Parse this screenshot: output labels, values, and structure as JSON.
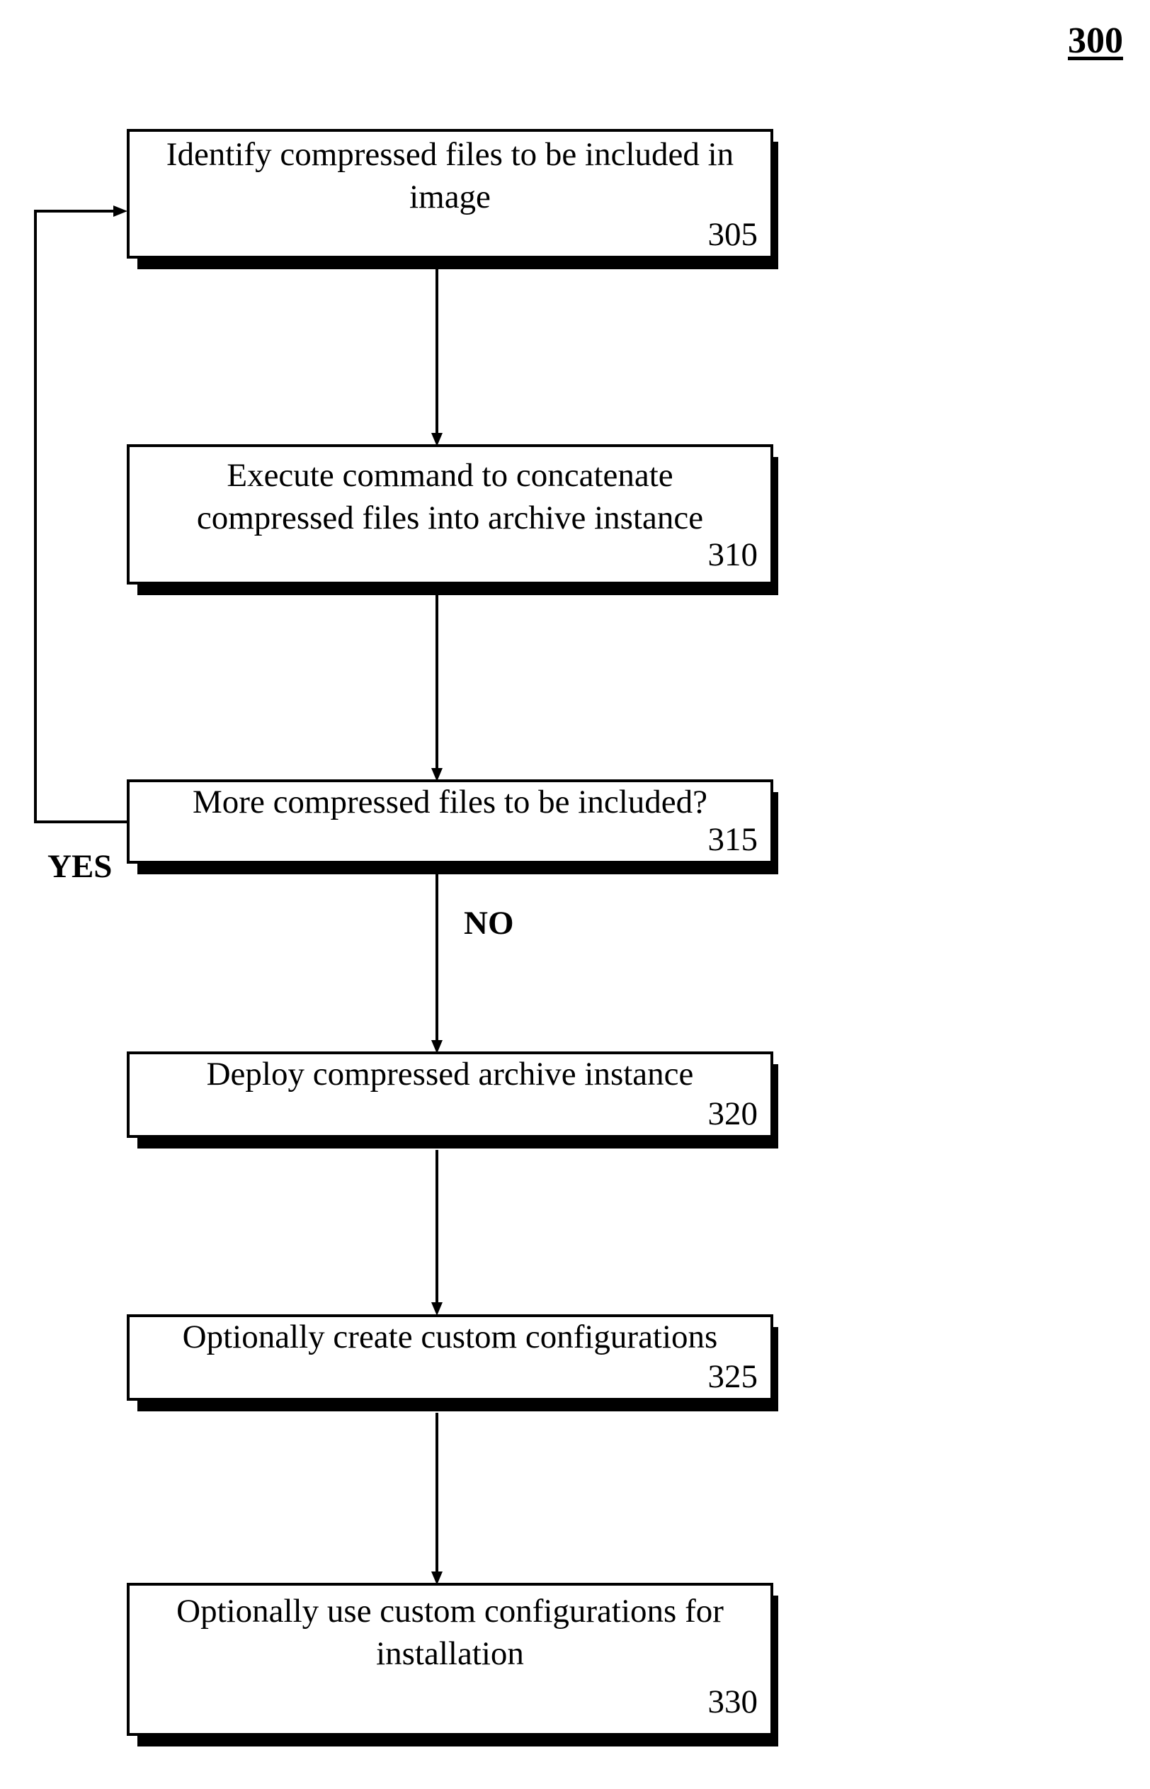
{
  "figure": {
    "number": "300"
  },
  "steps": [
    {
      "id": "305",
      "text": "Identify compressed files to be included in image",
      "lines": [
        "Identify compressed files to be included in",
        "image"
      ]
    },
    {
      "id": "310",
      "text": "Execute command to concatenate compressed files into archive instance",
      "lines": [
        "Execute command to concatenate",
        "compressed files into archive instance"
      ]
    },
    {
      "id": "315",
      "text": "More compressed files to be included?",
      "lines": [
        "More compressed files to be included?"
      ]
    },
    {
      "id": "320",
      "text": "Deploy compressed archive instance",
      "lines": [
        "Deploy compressed archive instance"
      ]
    },
    {
      "id": "325",
      "text": "Optionally create custom configurations",
      "lines": [
        "Optionally create custom configurations"
      ]
    },
    {
      "id": "330",
      "text": "Optionally use custom configurations for installation",
      "lines": [
        "Optionally use custom configurations for",
        "installation"
      ]
    }
  ],
  "branches": {
    "yes_label": "YES",
    "no_label": "NO"
  },
  "edges": [
    {
      "from": "305",
      "to": "310"
    },
    {
      "from": "310",
      "to": "315"
    },
    {
      "from": "315",
      "to": "305",
      "label": "YES"
    },
    {
      "from": "315",
      "to": "320",
      "label": "NO"
    },
    {
      "from": "320",
      "to": "325"
    },
    {
      "from": "325",
      "to": "330"
    }
  ]
}
